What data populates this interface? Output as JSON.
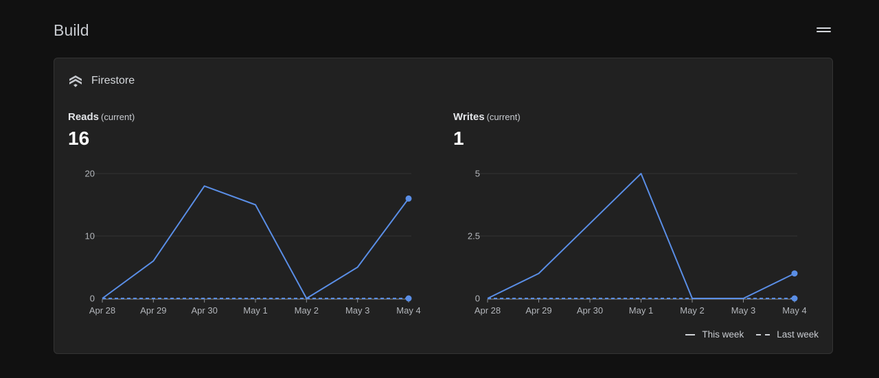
{
  "section": {
    "title": "Build"
  },
  "card": {
    "service_name": "Firestore",
    "service_icon": "firestore-icon"
  },
  "metrics": {
    "reads": {
      "label": "Reads",
      "qualifier": "(current)",
      "value": "16"
    },
    "writes": {
      "label": "Writes",
      "qualifier": "(current)",
      "value": "1"
    }
  },
  "legend": {
    "this_week": "This week",
    "last_week": "Last week"
  },
  "colors": {
    "accent": "#5a8ee6",
    "background": "#111111",
    "card": "#212121",
    "grid": "#333333"
  },
  "chart_data": [
    {
      "type": "line",
      "categories": [
        "Apr 28",
        "Apr 29",
        "Apr 30",
        "May 1",
        "May 2",
        "May 3",
        "May 4"
      ],
      "yticks": [
        0,
        10,
        20
      ],
      "ylim": [
        0,
        20
      ],
      "series": [
        {
          "name": "This week",
          "values": [
            0,
            6,
            18,
            15,
            0,
            5,
            16
          ]
        },
        {
          "name": "Last week",
          "values": [
            0,
            0,
            0,
            0,
            0,
            0,
            0
          ]
        }
      ],
      "grid": true,
      "legend": "bottom-right"
    },
    {
      "type": "line",
      "categories": [
        "Apr 28",
        "Apr 29",
        "Apr 30",
        "May 1",
        "May 2",
        "May 3",
        "May 4"
      ],
      "yticks": [
        0,
        2.5,
        5
      ],
      "ylim": [
        0,
        5
      ],
      "series": [
        {
          "name": "This week",
          "values": [
            0,
            1,
            3,
            5,
            0,
            0,
            1
          ]
        },
        {
          "name": "Last week",
          "values": [
            0,
            0,
            0,
            0,
            0,
            0,
            0
          ]
        }
      ],
      "grid": true,
      "legend": "bottom-right"
    }
  ]
}
